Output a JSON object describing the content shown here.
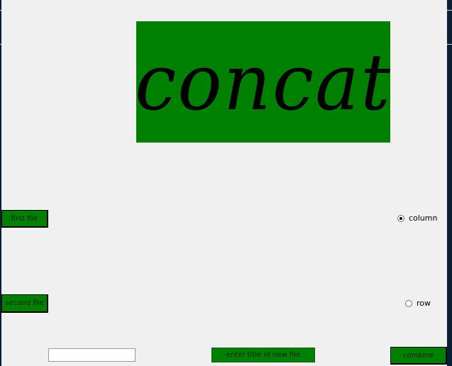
{
  "banner": {
    "text": "concat",
    "color": "#008000"
  },
  "buttons": {
    "first_file": "first file",
    "second_file": "second file",
    "enter_title": "enter title of new file",
    "combine": "combine",
    "color": "#008000"
  },
  "orientation": {
    "options": [
      {
        "label": "column",
        "selected": true
      },
      {
        "label": "row",
        "selected": false
      }
    ]
  },
  "title_input": {
    "value": "",
    "placeholder": ""
  }
}
